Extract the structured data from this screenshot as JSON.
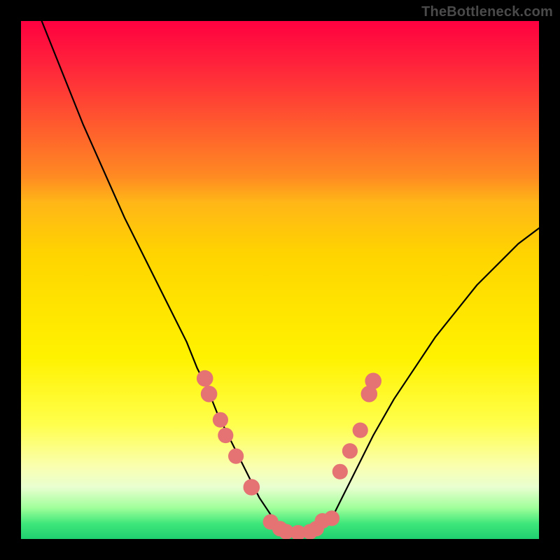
{
  "watermark": "TheBottleneck.com",
  "chart_data": {
    "type": "line",
    "title": "",
    "xlabel": "",
    "ylabel": "",
    "xlim": [
      0,
      100
    ],
    "ylim": [
      0,
      100
    ],
    "series": [
      {
        "name": "curve",
        "x": [
          4,
          6,
          8,
          10,
          12,
          16,
          20,
          24,
          28,
          32,
          34,
          36,
          38,
          40,
          42,
          44,
          46,
          48,
          50,
          52,
          54,
          56,
          58,
          60,
          62,
          64,
          68,
          72,
          76,
          80,
          84,
          88,
          92,
          96,
          100
        ],
        "y": [
          100,
          95,
          90,
          85,
          80,
          71,
          62,
          54,
          46,
          38,
          33,
          29,
          24,
          20,
          16,
          12,
          8,
          5,
          2,
          1,
          1,
          1,
          2,
          4,
          8,
          12,
          20,
          27,
          33,
          39,
          44,
          49,
          53,
          57,
          60
        ]
      }
    ],
    "markers": [
      {
        "x": 35.5,
        "y": 31,
        "r": 1.6
      },
      {
        "x": 36.3,
        "y": 28,
        "r": 1.6
      },
      {
        "x": 38.5,
        "y": 23,
        "r": 1.5
      },
      {
        "x": 39.5,
        "y": 20,
        "r": 1.5
      },
      {
        "x": 41.5,
        "y": 16,
        "r": 1.5
      },
      {
        "x": 44.5,
        "y": 10,
        "r": 1.6
      },
      {
        "x": 48.2,
        "y": 3.3,
        "r": 1.5
      },
      {
        "x": 50.0,
        "y": 2,
        "r": 1.5
      },
      {
        "x": 51.2,
        "y": 1.4,
        "r": 1.5
      },
      {
        "x": 53.5,
        "y": 1.2,
        "r": 1.5
      },
      {
        "x": 55.8,
        "y": 1.4,
        "r": 1.5
      },
      {
        "x": 57.0,
        "y": 2,
        "r": 1.5
      },
      {
        "x": 58.2,
        "y": 3.5,
        "r": 1.5
      },
      {
        "x": 60.0,
        "y": 4,
        "r": 1.5
      },
      {
        "x": 61.6,
        "y": 13,
        "r": 1.5
      },
      {
        "x": 63.5,
        "y": 17,
        "r": 1.5
      },
      {
        "x": 65.5,
        "y": 21,
        "r": 1.5
      },
      {
        "x": 67.2,
        "y": 28,
        "r": 1.6
      },
      {
        "x": 68.0,
        "y": 30.5,
        "r": 1.6
      }
    ],
    "marker_color": "#e57373",
    "curve_color": "#000000"
  }
}
